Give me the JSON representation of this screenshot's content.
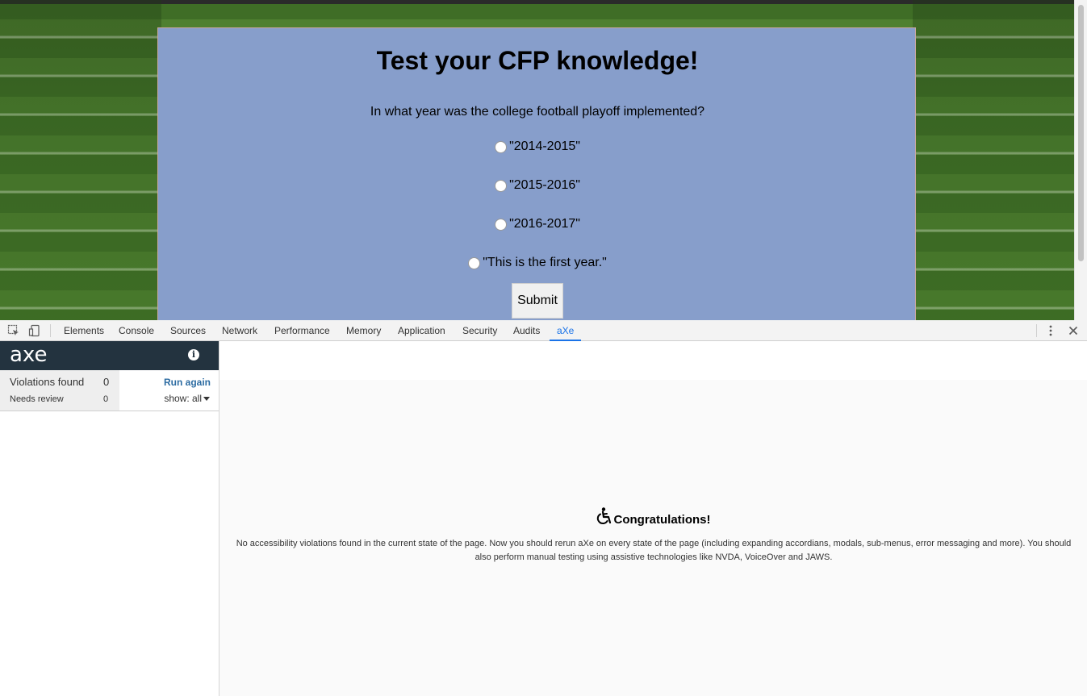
{
  "quiz": {
    "title": "Test your CFP knowledge!",
    "question": "In what year was the college football playoff implemented?",
    "options": [
      "\"2014-2015\"",
      "\"2015-2016\"",
      "\"2016-2017\"",
      "\"This is the first year.\""
    ],
    "submit_label": "Submit"
  },
  "devtools": {
    "tabs": [
      "Elements",
      "Console",
      "Sources",
      "Network",
      "Performance",
      "Memory",
      "Application",
      "Security",
      "Audits",
      "aXe"
    ],
    "active_tab": "aXe"
  },
  "axe": {
    "logo": "axe",
    "info_icon": "i",
    "violations_label": "Violations found",
    "violations_count": "0",
    "needs_review_label": "Needs review",
    "needs_review_count": "0",
    "run_again": "Run again",
    "show_filter": "show: all",
    "congrats_title": "Congratulations!",
    "congrats_text": "No accessibility violations found in the current state of the page. Now you should rerun aXe on every state of the page (including expanding accordians, modals, sub-menus, error messaging and more). You should also perform manual testing using assistive technologies like NVDA, VoiceOver and JAWS."
  },
  "colors": {
    "quiz_card": "#879ecb",
    "axe_header": "#23333f",
    "active_tab": "#1a73e8",
    "run_again": "#2d6ca2"
  }
}
